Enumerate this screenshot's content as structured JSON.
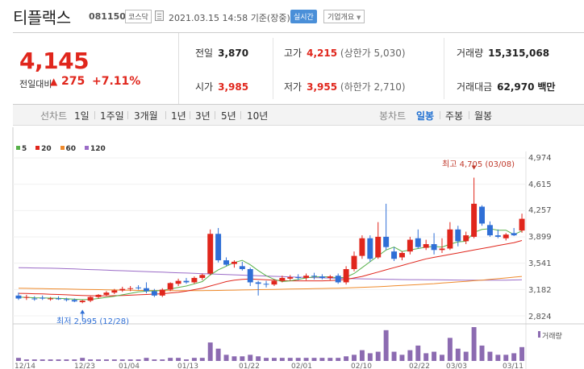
{
  "header": {
    "name": "티플랙스",
    "code": "081150",
    "market": "코스닥",
    "timestamp": "2021.03.15 14:58",
    "basis": "기준(장중)",
    "realtime_label": "실시간",
    "overview_label": "기업개요"
  },
  "quote": {
    "price": "4,145",
    "change_label": "전일대비",
    "change_value": "275",
    "change_pct": "+7.11%",
    "prev_close_label": "전일",
    "prev_close": "3,870",
    "open_label": "시가",
    "open": "3,985",
    "high_label": "고가",
    "high": "4,215",
    "upper_limit": "(상한가 5,030)",
    "low_label": "저가",
    "low": "3,955",
    "lower_limit": "(하한가 2,710)",
    "volume_label": "거래량",
    "volume": "15,315,068",
    "turnover_label": "거래대금",
    "turnover": "62,970",
    "turnover_unit": "백만"
  },
  "periods": {
    "section_label": "선차트",
    "items": [
      "1일",
      "1주일",
      "3개월",
      "1년",
      "3년",
      "5년",
      "10년"
    ]
  },
  "candle_tabs": {
    "section_label": "봉차트",
    "items": [
      "일봉",
      "주봉",
      "월봉"
    ],
    "active": "일봉"
  },
  "colors": {
    "up": "#e0261c",
    "down": "#2f6fd6",
    "accent": "#1f6fd1",
    "ma5": "#58b14a",
    "ma20": "#e0261c",
    "ma60": "#ef8a2b",
    "ma120": "#9b6cc7",
    "volume": "#8c6bb1"
  },
  "chart_data": {
    "type": "candlestick",
    "legend": [
      "5",
      "20",
      "60",
      "120"
    ],
    "y_ticks": [
      "4,974",
      "4,615",
      "4,257",
      "3,899",
      "3,541",
      "3,182",
      "2,824"
    ],
    "ylim": [
      2824,
      4974
    ],
    "x_ticks": [
      "12/14",
      "12/23",
      "01/04",
      "01/13",
      "01/22",
      "02/01",
      "02/10",
      "02/22",
      "03/03",
      "03/11"
    ],
    "high_annotation": "최고 4,705 (03/08)",
    "low_annotation": "최저 2,995 (12/28)",
    "volume_label": "거래량",
    "candles": [
      {
        "o": 3100,
        "h": 3140,
        "l": 3040,
        "c": 3060
      },
      {
        "o": 3070,
        "h": 3110,
        "l": 3040,
        "c": 3080
      },
      {
        "o": 3060,
        "h": 3090,
        "l": 3030,
        "c": 3050
      },
      {
        "o": 3070,
        "h": 3100,
        "l": 3040,
        "c": 3060
      },
      {
        "o": 3050,
        "h": 3080,
        "l": 3030,
        "c": 3060
      },
      {
        "o": 3060,
        "h": 3090,
        "l": 3040,
        "c": 3050
      },
      {
        "o": 3050,
        "h": 3070,
        "l": 3020,
        "c": 3040
      },
      {
        "o": 3040,
        "h": 3060,
        "l": 3010,
        "c": 3020
      },
      {
        "o": 3010,
        "h": 3040,
        "l": 2995,
        "c": 3030
      },
      {
        "o": 3030,
        "h": 3090,
        "l": 3010,
        "c": 3080
      },
      {
        "o": 3080,
        "h": 3120,
        "l": 3060,
        "c": 3110
      },
      {
        "o": 3110,
        "h": 3160,
        "l": 3090,
        "c": 3140
      },
      {
        "o": 3140,
        "h": 3190,
        "l": 3120,
        "c": 3170
      },
      {
        "o": 3170,
        "h": 3220,
        "l": 3150,
        "c": 3190
      },
      {
        "o": 3190,
        "h": 3230,
        "l": 3160,
        "c": 3200
      },
      {
        "o": 3210,
        "h": 3240,
        "l": 3180,
        "c": 3200
      },
      {
        "o": 3200,
        "h": 3280,
        "l": 3130,
        "c": 3160
      },
      {
        "o": 3160,
        "h": 3190,
        "l": 3080,
        "c": 3100
      },
      {
        "o": 3100,
        "h": 3200,
        "l": 3080,
        "c": 3180
      },
      {
        "o": 3180,
        "h": 3280,
        "l": 3160,
        "c": 3270
      },
      {
        "o": 3260,
        "h": 3330,
        "l": 3230,
        "c": 3300
      },
      {
        "o": 3300,
        "h": 3340,
        "l": 3260,
        "c": 3280
      },
      {
        "o": 3280,
        "h": 3360,
        "l": 3260,
        "c": 3340
      },
      {
        "o": 3340,
        "h": 3400,
        "l": 3310,
        "c": 3380
      },
      {
        "o": 3400,
        "h": 4000,
        "l": 3380,
        "c": 3940
      },
      {
        "o": 3940,
        "h": 4020,
        "l": 3550,
        "c": 3580
      },
      {
        "o": 3580,
        "h": 3620,
        "l": 3500,
        "c": 3520
      },
      {
        "o": 3530,
        "h": 3580,
        "l": 3480,
        "c": 3560
      },
      {
        "o": 3500,
        "h": 3560,
        "l": 3440,
        "c": 3460
      },
      {
        "o": 3460,
        "h": 3480,
        "l": 3230,
        "c": 3280
      },
      {
        "o": 3280,
        "h": 3300,
        "l": 3100,
        "c": 3260
      },
      {
        "o": 3260,
        "h": 3300,
        "l": 3210,
        "c": 3250
      },
      {
        "o": 3250,
        "h": 3320,
        "l": 3230,
        "c": 3300
      },
      {
        "o": 3300,
        "h": 3370,
        "l": 3280,
        "c": 3340
      },
      {
        "o": 3330,
        "h": 3380,
        "l": 3300,
        "c": 3350
      },
      {
        "o": 3350,
        "h": 3390,
        "l": 3310,
        "c": 3340
      },
      {
        "o": 3340,
        "h": 3400,
        "l": 3310,
        "c": 3370
      },
      {
        "o": 3370,
        "h": 3410,
        "l": 3320,
        "c": 3360
      },
      {
        "o": 3360,
        "h": 3390,
        "l": 3320,
        "c": 3340
      },
      {
        "o": 3340,
        "h": 3380,
        "l": 3310,
        "c": 3360
      },
      {
        "o": 3370,
        "h": 3400,
        "l": 3260,
        "c": 3280
      },
      {
        "o": 3280,
        "h": 3500,
        "l": 3250,
        "c": 3460
      },
      {
        "o": 3460,
        "h": 3700,
        "l": 3430,
        "c": 3640
      },
      {
        "o": 3640,
        "h": 3920,
        "l": 3600,
        "c": 3880
      },
      {
        "o": 3880,
        "h": 3920,
        "l": 3560,
        "c": 3600
      },
      {
        "o": 3620,
        "h": 4100,
        "l": 3600,
        "c": 3900
      },
      {
        "o": 3900,
        "h": 4350,
        "l": 3720,
        "c": 3760
      },
      {
        "o": 3700,
        "h": 3760,
        "l": 3570,
        "c": 3600
      },
      {
        "o": 3620,
        "h": 3700,
        "l": 3580,
        "c": 3680
      },
      {
        "o": 3700,
        "h": 3900,
        "l": 3660,
        "c": 3860
      },
      {
        "o": 3880,
        "h": 4000,
        "l": 3740,
        "c": 3760
      },
      {
        "o": 3750,
        "h": 3860,
        "l": 3720,
        "c": 3800
      },
      {
        "o": 3800,
        "h": 3950,
        "l": 3660,
        "c": 3720
      },
      {
        "o": 3720,
        "h": 3880,
        "l": 3680,
        "c": 3740
      },
      {
        "o": 3740,
        "h": 4100,
        "l": 3720,
        "c": 4000
      },
      {
        "o": 4000,
        "h": 4050,
        "l": 3770,
        "c": 3840
      },
      {
        "o": 3840,
        "h": 3970,
        "l": 3800,
        "c": 3920
      },
      {
        "o": 3900,
        "h": 4705,
        "l": 3880,
        "c": 4350
      },
      {
        "o": 4310,
        "h": 4330,
        "l": 4050,
        "c": 4080
      },
      {
        "o": 4060,
        "h": 4110,
        "l": 3900,
        "c": 3920
      },
      {
        "o": 3920,
        "h": 4000,
        "l": 3880,
        "c": 3900
      },
      {
        "o": 3880,
        "h": 3950,
        "l": 3850,
        "c": 3930
      },
      {
        "o": 3950,
        "h": 4020,
        "l": 3910,
        "c": 3920
      },
      {
        "o": 3985,
        "h": 4215,
        "l": 3955,
        "c": 4145
      }
    ],
    "ma5": [
      3080,
      3075,
      3070,
      3068,
      3065,
      3062,
      3058,
      3050,
      3045,
      3048,
      3060,
      3075,
      3090,
      3110,
      3130,
      3150,
      3160,
      3165,
      3170,
      3190,
      3210,
      3230,
      3260,
      3290,
      3380,
      3450,
      3500,
      3550,
      3580,
      3520,
      3440,
      3370,
      3320,
      3290,
      3300,
      3320,
      3340,
      3355,
      3355,
      3355,
      3340,
      3350,
      3400,
      3480,
      3560,
      3640,
      3720,
      3760,
      3700,
      3720,
      3740,
      3760,
      3770,
      3760,
      3800,
      3830,
      3840,
      3960,
      4000,
      4010,
      3990,
      3990,
      3930,
      3980
    ],
    "ma20": [
      3130,
      3128,
      3125,
      3122,
      3118,
      3115,
      3110,
      3105,
      3100,
      3098,
      3096,
      3096,
      3098,
      3100,
      3105,
      3110,
      3115,
      3120,
      3125,
      3135,
      3145,
      3160,
      3180,
      3200,
      3230,
      3260,
      3290,
      3310,
      3320,
      3325,
      3320,
      3315,
      3310,
      3305,
      3300,
      3300,
      3300,
      3300,
      3300,
      3305,
      3310,
      3320,
      3340,
      3360,
      3390,
      3420,
      3450,
      3480,
      3510,
      3540,
      3570,
      3600,
      3620,
      3640,
      3660,
      3680,
      3700,
      3720,
      3740,
      3760,
      3780,
      3800,
      3820,
      3850
    ],
    "ma60": [
      3200,
      3198,
      3196,
      3194,
      3192,
      3190,
      3188,
      3186,
      3184,
      3182,
      3180,
      3178,
      3176,
      3174,
      3172,
      3170,
      3169,
      3168,
      3167,
      3166,
      3166,
      3166,
      3166,
      3167,
      3168,
      3170,
      3172,
      3174,
      3176,
      3178,
      3180,
      3182,
      3184,
      3186,
      3188,
      3190,
      3192,
      3194,
      3196,
      3198,
      3200,
      3204,
      3208,
      3212,
      3216,
      3220,
      3226,
      3232,
      3238,
      3244,
      3250,
      3256,
      3262,
      3270,
      3278,
      3286,
      3294,
      3302,
      3310,
      3320,
      3330,
      3340,
      3350,
      3360
    ],
    "ma120": [
      3480,
      3478,
      3476,
      3474,
      3472,
      3470,
      3466,
      3462,
      3458,
      3454,
      3450,
      3446,
      3442,
      3438,
      3434,
      3430,
      3426,
      3422,
      3418,
      3414,
      3410,
      3406,
      3402,
      3398,
      3394,
      3390,
      3386,
      3382,
      3378,
      3374,
      3370,
      3366,
      3362,
      3358,
      3354,
      3350,
      3347,
      3344,
      3341,
      3338,
      3335,
      3332,
      3330,
      3328,
      3326,
      3324,
      3322,
      3320,
      3318,
      3317,
      3316,
      3315,
      3314,
      3313,
      3312,
      3311,
      3310,
      3310,
      3310,
      3310,
      3310,
      3310,
      3312,
      3314
    ],
    "volume": [
      2,
      1,
      1,
      1,
      1,
      1,
      1,
      1,
      2,
      1,
      1,
      1,
      1,
      1,
      1,
      1,
      2,
      1,
      1,
      2,
      2,
      1,
      2,
      2,
      12,
      8,
      4,
      3,
      3,
      4,
      3,
      2,
      2,
      2,
      2,
      2,
      2,
      2,
      2,
      2,
      2,
      3,
      4,
      7,
      5,
      6,
      20,
      6,
      4,
      7,
      10,
      5,
      6,
      4,
      15,
      8,
      6,
      22,
      10,
      6,
      4,
      4,
      5,
      9
    ]
  }
}
